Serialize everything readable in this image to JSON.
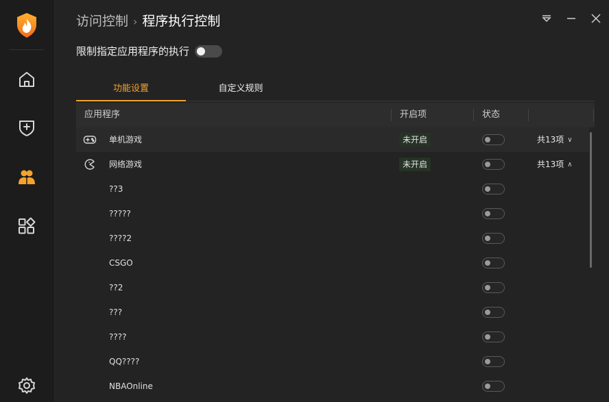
{
  "breadcrumb": {
    "parent": "访问控制",
    "separator": "›",
    "current": "程序执行控制"
  },
  "master_toggle": {
    "label": "限制指定应用程序的执行",
    "state": "off"
  },
  "tabs": [
    {
      "label": "功能设置",
      "active": true
    },
    {
      "label": "自定义规则",
      "active": false
    }
  ],
  "table": {
    "headers": {
      "app": "应用程序",
      "startup": "开启项",
      "status": "状态"
    },
    "categories": [
      {
        "name": "单机游戏",
        "icon": "gamepad-icon",
        "badge": "未开启",
        "status": "off",
        "count": "共13项",
        "chevron": "∨"
      },
      {
        "name": "网络游戏",
        "icon": "pacman-icon",
        "badge": "未开启",
        "status": "off",
        "count": "共13项",
        "chevron": "∧"
      }
    ],
    "items": [
      {
        "name": "??3",
        "status": "off"
      },
      {
        "name": "?????",
        "status": "off"
      },
      {
        "name": "????2",
        "status": "off"
      },
      {
        "name": "CSGO",
        "status": "off"
      },
      {
        "name": "??2",
        "status": "off"
      },
      {
        "name": "???",
        "status": "off"
      },
      {
        "name": "????",
        "status": "off"
      },
      {
        "name": "QQ????",
        "status": "off"
      },
      {
        "name": "NBAOnline",
        "status": "off"
      }
    ]
  },
  "sidebar": {
    "items": [
      {
        "icon": "home-icon",
        "active": false
      },
      {
        "icon": "shield-plus-icon",
        "active": false
      },
      {
        "icon": "users-icon",
        "active": true
      },
      {
        "icon": "apps-icon",
        "active": false
      }
    ],
    "bottom_icon": "settings-icon"
  },
  "colors": {
    "accent": "#f4a32c",
    "background": "#232323",
    "sidebar": "#1c1c1c",
    "badge_bg": "#263326"
  }
}
